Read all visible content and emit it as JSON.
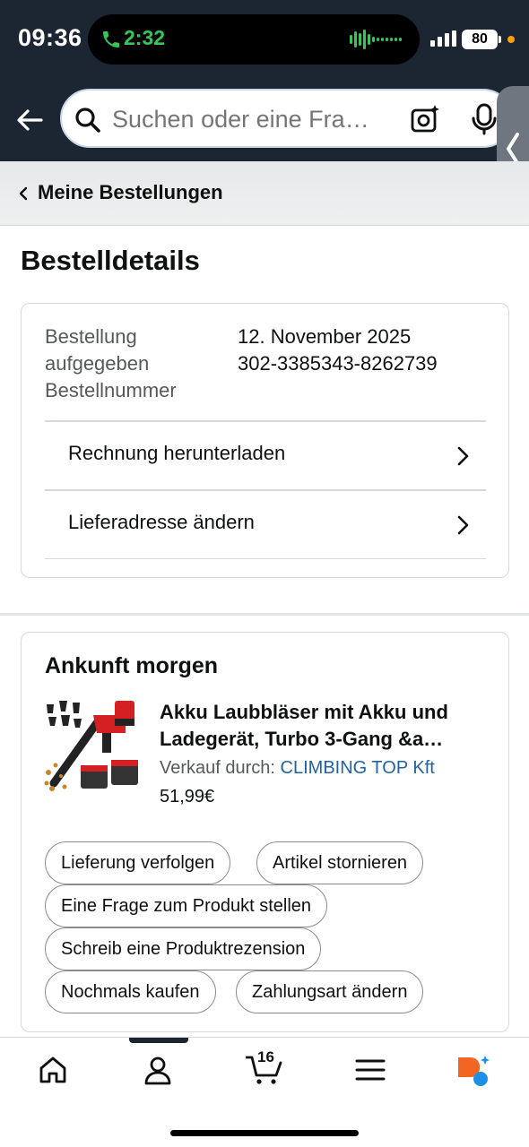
{
  "status_bar": {
    "time": "09:36",
    "call_time": "2:32",
    "battery": "80"
  },
  "search": {
    "placeholder": "Suchen oder eine Fra…"
  },
  "breadcrumb": {
    "label": "Meine Bestellungen"
  },
  "page_title": "Bestelldetails",
  "order_info": {
    "placed_label": "Bestellung aufgegeben",
    "placed_label_line1": "Bestellung",
    "placed_label_line2": "aufgegeben",
    "placed_value": "12. November 2025",
    "number_label": "Bestellnummer",
    "number_value": "302-3385343-8262739"
  },
  "actions": [
    {
      "label": "Rechnung herunterladen"
    },
    {
      "label": "Lieferadresse ändern"
    }
  ],
  "shipment": {
    "status": "Ankunft morgen",
    "product": {
      "title_line1": "Akku Laubbläser mit Akku und",
      "title_line2": "Ladegerät, Turbo 3-Gang &a…",
      "seller_prefix": "Verkauf durch:",
      "seller": "CLIMBING TOP Kft",
      "price": "51,99€"
    },
    "buttons": [
      {
        "label": "Lieferung verfolgen"
      },
      {
        "label": "Artikel stornieren"
      },
      {
        "label": "Eine Frage zum Produkt stellen"
      },
      {
        "label": "Schreib eine Produktrezension"
      },
      {
        "label": "Nochmals kaufen"
      },
      {
        "label": "Zahlungsart ändern"
      }
    ]
  },
  "bottom_nav": {
    "cart_count": "16"
  },
  "colors": {
    "header_bg": "#1c2532",
    "link": "#2162a1",
    "call_green": "#34c759"
  }
}
